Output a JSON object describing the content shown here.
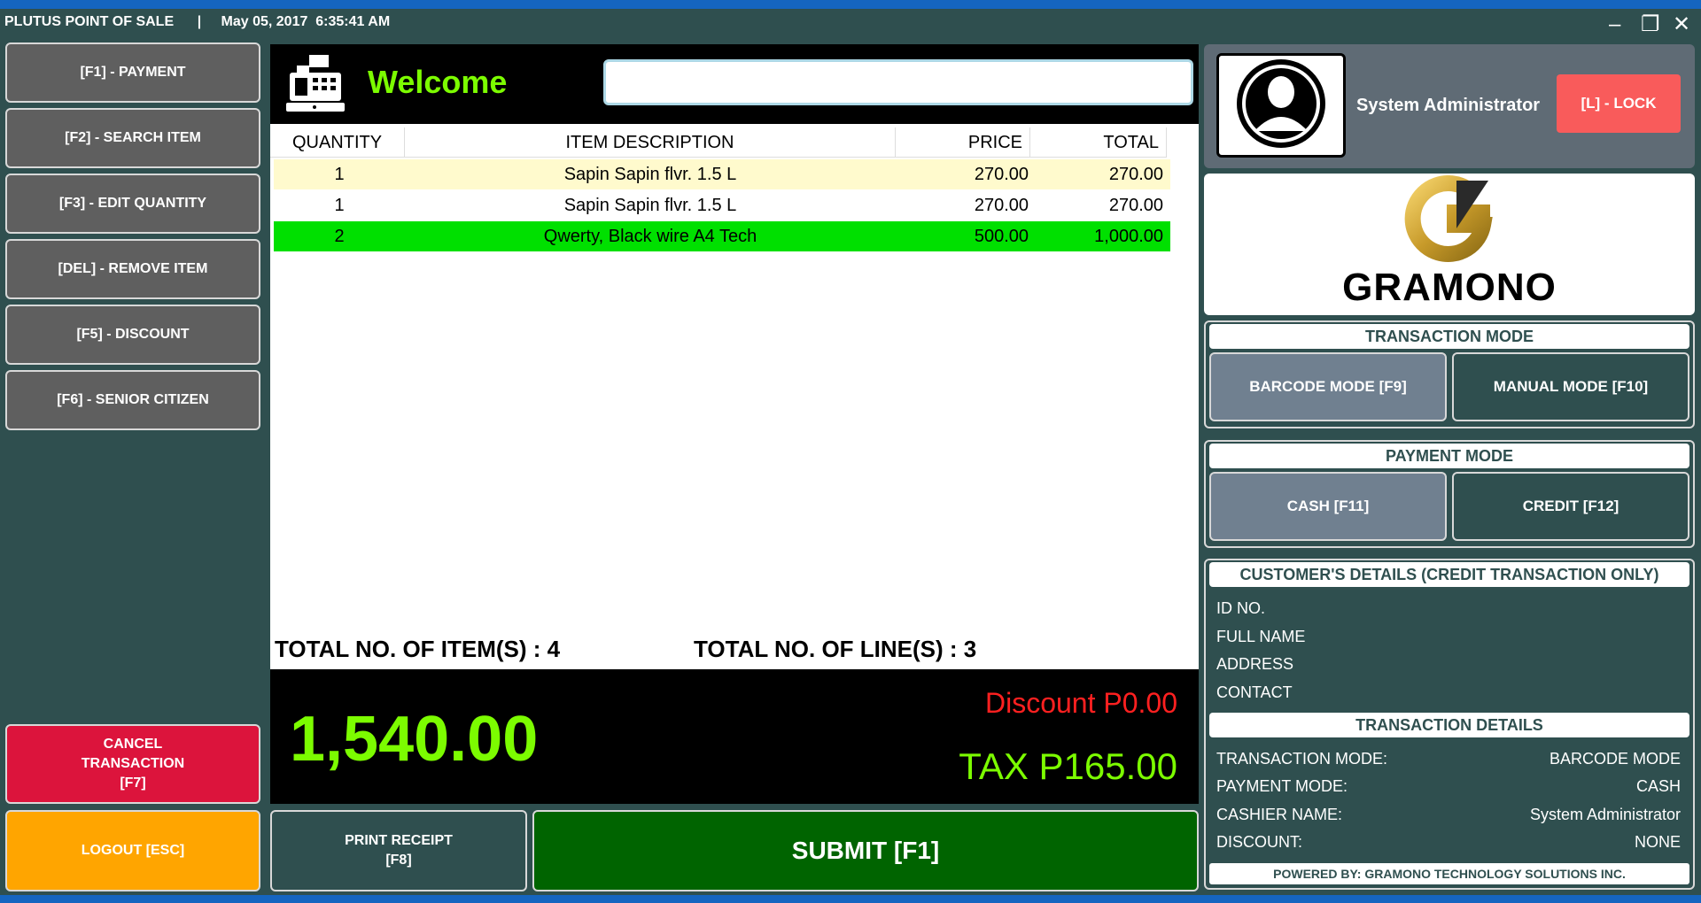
{
  "titlebar": {
    "app_name": "PLUTUS POINT OF SALE",
    "separator": "|",
    "datetime": "May 05, 2017  6:35:41 AM",
    "minimize": "–",
    "maximize": "❐",
    "close": "✕"
  },
  "sidebar": {
    "payment": "[F1] - PAYMENT",
    "search_item": "[F2] - SEARCH ITEM",
    "edit_quantity": "[F3] - EDIT  QUANTITY",
    "remove_item": "[DEL] - REMOVE  ITEM",
    "discount": "[F5] - DISCOUNT",
    "senior_citizen": "[F6] - SENIOR CITIZEN",
    "cancel_line1": "CANCEL",
    "cancel_line2": "TRANSACTION",
    "cancel_line3": "[F7]",
    "logout": "LOGOUT [ESC]"
  },
  "header": {
    "welcome": "Welcome",
    "scan_value": "",
    "icon": "cash-register-icon"
  },
  "table": {
    "columns": [
      "QUANTITY",
      "ITEM DESCRIPTION",
      "PRICE",
      "TOTAL"
    ],
    "rows": [
      {
        "quantity": "1",
        "description": "Sapin Sapin flvr. 1.5 L",
        "price": "270.00",
        "total": "270.00"
      },
      {
        "quantity": "1",
        "description": "Sapin Sapin flvr. 1.5 L",
        "price": "270.00",
        "total": "270.00"
      },
      {
        "quantity": "2",
        "description": "Qwerty, Black wire A4 Tech",
        "price": "500.00",
        "total": "1,000.00"
      }
    ]
  },
  "summary": {
    "total_items": "TOTAL NO. OF ITEM(S) : 4",
    "total_lines": "TOTAL NO. OF LINE(S) : 3",
    "grand_total": "1,540.00",
    "discount": "Discount P0.00",
    "tax": "TAX P165.00"
  },
  "actions": {
    "print_line1": "PRINT RECEIPT",
    "print_line2": "[F8]",
    "submit": "SUBMIT [F1]"
  },
  "user": {
    "name": "System Administrator",
    "lock": "[L] - LOCK",
    "avatar_icon": "user-silhouette-icon"
  },
  "logo": {
    "text": "GRAMONO"
  },
  "transaction_mode": {
    "title": "TRANSACTION MODE",
    "barcode": "BARCODE MODE [F9]",
    "manual": "MANUAL MODE [F10]",
    "selected": "barcode"
  },
  "payment_mode": {
    "title": "PAYMENT MODE",
    "cash": "CASH [F11]",
    "credit": "CREDIT [F12]",
    "selected": "cash"
  },
  "customer": {
    "title": "CUSTOMER'S DETAILS (CREDIT TRANSACTION ONLY)",
    "id_label": "ID NO.",
    "name_label": "FULL NAME",
    "address_label": "ADDRESS",
    "contact_label": "CONTACT"
  },
  "transaction_details": {
    "title": "TRANSACTION DETAILS",
    "mode_label": "TRANSACTION MODE:",
    "mode_value": "BARCODE MODE",
    "payment_label": "PAYMENT MODE:",
    "payment_value": "CASH",
    "cashier_label": "CASHIER NAME:",
    "cashier_value": "System Administrator",
    "discount_label": "DISCOUNT:",
    "discount_value": "NONE"
  },
  "footer": "POWERED BY: GRAMONO TECHNOLOGY SOLUTIONS INC.",
  "colors": {
    "background": "#2f4f4f",
    "accent_green": "#7cfc00",
    "highlight_row": "#00e000",
    "selected_row": "#fffacd",
    "cancel": "#dc143c",
    "logout": "#ffa500",
    "submit": "#006400",
    "lock": "#f95b5b"
  }
}
